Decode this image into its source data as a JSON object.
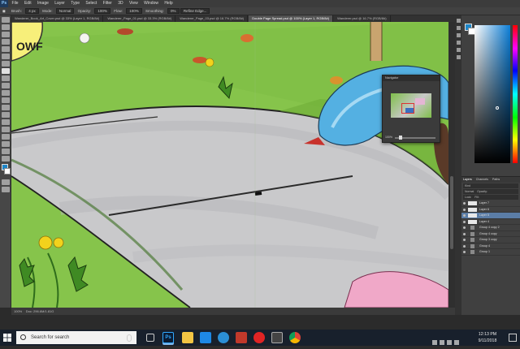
{
  "menubar": {
    "app_icon": "photoshop-logo-icon",
    "items": [
      "File",
      "Edit",
      "Image",
      "Layer",
      "Type",
      "Select",
      "Filter",
      "3D",
      "View",
      "Window",
      "Help"
    ]
  },
  "options_bar": {
    "brush_label": "Brush:",
    "brush_size": "4 px",
    "mode_label": "Mode:",
    "mode_value": "Normal",
    "opacity_label": "Opacity:",
    "opacity_value": "100%",
    "flow_label": "Flow:",
    "flow_value": "100%",
    "smoothing_label": "Smoothing:",
    "smoothing_value": "0%",
    "refine_button": "Refine Edge..."
  },
  "document_tabs": [
    {
      "label": "Wanderer_Book_Art_Cover.psd @ 33% (Layer 1, RGB/8#)",
      "active": false
    },
    {
      "label": "Wanderer_Page_01.psd @ 33.3% (RGB/8#)",
      "active": false
    },
    {
      "label": "Wanderer_Page_03.psd @ 16.7% (RGB/8#)",
      "active": false
    },
    {
      "label": "Double Page Spread.psd @ 100% (Layer 1, RGB/8#)",
      "active": true
    },
    {
      "label": "Wanderer.psd @ 16.7% (RGB/8#)",
      "active": false
    }
  ],
  "canvas_sign_text": "OWF",
  "navigator": {
    "title": "Navigator",
    "zoom": "100%"
  },
  "status_bar": {
    "zoom": "100%",
    "doc_info": "Doc: 296.6M/1.81G"
  },
  "layers_panel": {
    "tabs": [
      "Layers",
      "Channels",
      "Paths"
    ],
    "kind_label": "Kind",
    "blend_mode": "Normal",
    "opacity_label": "Opacity:",
    "fill_label": "Fill:",
    "lock_label": "Lock:",
    "layers": [
      {
        "name": "Layer 7",
        "type": "layer",
        "selected": false
      },
      {
        "name": "Layer 6",
        "type": "layer",
        "selected": false
      },
      {
        "name": "Layer 5",
        "type": "layer",
        "selected": true
      },
      {
        "name": "Layer 4",
        "type": "layer",
        "selected": false
      },
      {
        "name": "Group 4 copy 2",
        "type": "folder",
        "selected": false
      },
      {
        "name": "Group 4 copy",
        "type": "folder",
        "selected": false
      },
      {
        "name": "Group 3 copy",
        "type": "folder",
        "selected": false
      },
      {
        "name": "Group 4",
        "type": "folder",
        "selected": false
      },
      {
        "name": "Group 1",
        "type": "folder",
        "selected": false
      }
    ]
  },
  "colors": {
    "foreground": "#1d86c8",
    "background": "#ffffff",
    "grass": "#86c44b",
    "path": "#c9c9cb"
  },
  "taskbar": {
    "search_placeholder": "Search for search",
    "time": "12:13 PM",
    "date": "9/11/2018",
    "apps": [
      "task-view-icon",
      "photoshop-icon",
      "file-explorer-icon",
      "store-icon",
      "edge-icon",
      "photos-icon",
      "opera-icon",
      "mail-icon",
      "chrome-icon"
    ]
  }
}
